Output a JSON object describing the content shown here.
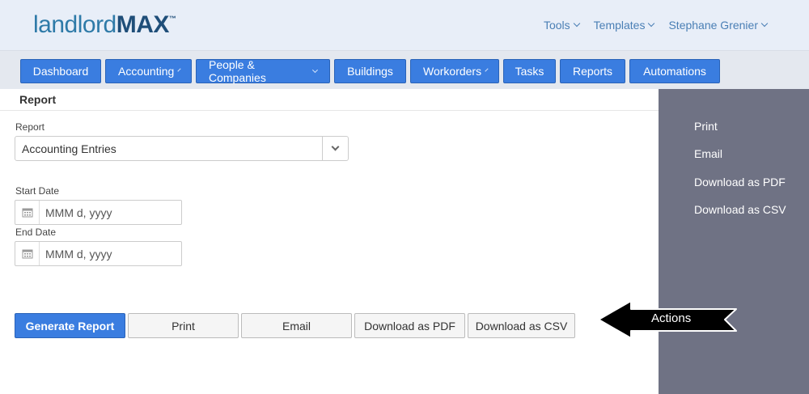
{
  "brand": {
    "name_light": "landlord",
    "name_bold": "MAX",
    "trademark": "™"
  },
  "topnav": [
    {
      "label": "Tools"
    },
    {
      "label": "Templates"
    },
    {
      "label": "Stephane Grenier"
    }
  ],
  "navbar": [
    {
      "label": "Dashboard",
      "dropdown": false
    },
    {
      "label": "Accounting",
      "dropdown": true
    },
    {
      "label": "People & Companies",
      "dropdown": true
    },
    {
      "label": "Buildings",
      "dropdown": false
    },
    {
      "label": "Workorders",
      "dropdown": true
    },
    {
      "label": "Tasks",
      "dropdown": false
    },
    {
      "label": "Reports",
      "dropdown": false
    },
    {
      "label": "Automations",
      "dropdown": false
    }
  ],
  "page": {
    "title": "Report"
  },
  "form": {
    "report_label": "Report",
    "report_value": "Accounting Entries",
    "start_label": "Start Date",
    "start_placeholder": "MMM d, yyyy",
    "end_label": "End Date",
    "end_placeholder": "MMM d, yyyy"
  },
  "actions": {
    "generate": "Generate Report",
    "print": "Print",
    "email": "Email",
    "pdf": "Download as PDF",
    "csv": "Download as CSV"
  },
  "sidebar": {
    "links": [
      "Print",
      "Email",
      "Download as PDF",
      "Download as CSV"
    ]
  },
  "callout": {
    "text": "Actions"
  },
  "colors": {
    "accent": "#3a7de0",
    "sidebar": "#6f7284",
    "header": "#e8eef8"
  }
}
